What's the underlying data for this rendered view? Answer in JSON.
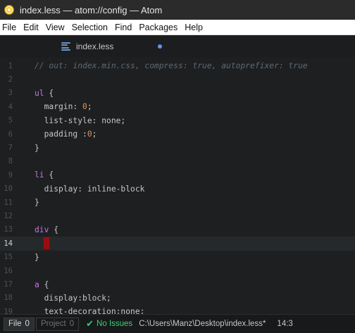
{
  "window": {
    "title": "index.less — atom://config — Atom"
  },
  "menu": [
    "File",
    "Edit",
    "View",
    "Selection",
    "Find",
    "Packages",
    "Help"
  ],
  "tab": {
    "label": "index.less",
    "modified": true
  },
  "editor": {
    "cursor_line": 14,
    "lines": [
      {
        "n": "1",
        "tokens": [
          {
            "t": "// out: index.min.css, compress: true, autoprefixer: true",
            "c": "comment"
          }
        ]
      },
      {
        "n": "2",
        "tokens": []
      },
      {
        "n": "3",
        "tokens": [
          {
            "t": "ul",
            "c": "sel"
          },
          {
            "t": " {",
            "c": "plain"
          }
        ]
      },
      {
        "n": "4",
        "tokens": [
          {
            "t": "  margin",
            "c": "prop"
          },
          {
            "t": ": ",
            "c": "plain"
          },
          {
            "t": "0",
            "c": "num"
          },
          {
            "t": ";",
            "c": "plain"
          }
        ]
      },
      {
        "n": "5",
        "tokens": [
          {
            "t": "  list-style",
            "c": "prop"
          },
          {
            "t": ": none;",
            "c": "plain"
          }
        ]
      },
      {
        "n": "6",
        "tokens": [
          {
            "t": "  padding",
            "c": "prop"
          },
          {
            "t": " :",
            "c": "plain"
          },
          {
            "t": "0",
            "c": "num"
          },
          {
            "t": ";",
            "c": "plain"
          }
        ]
      },
      {
        "n": "7",
        "tokens": [
          {
            "t": "}",
            "c": "plain"
          }
        ]
      },
      {
        "n": "8",
        "tokens": []
      },
      {
        "n": "9",
        "tokens": [
          {
            "t": "li",
            "c": "sel"
          },
          {
            "t": " {",
            "c": "plain"
          }
        ]
      },
      {
        "n": "10",
        "tokens": [
          {
            "t": "  display",
            "c": "prop"
          },
          {
            "t": ": inline-block",
            "c": "plain"
          }
        ]
      },
      {
        "n": "11",
        "tokens": [
          {
            "t": "}",
            "c": "plain"
          }
        ]
      },
      {
        "n": "12",
        "tokens": []
      },
      {
        "n": "13",
        "tokens": [
          {
            "t": "div",
            "c": "sel"
          },
          {
            "t": " {",
            "c": "plain"
          }
        ]
      },
      {
        "n": "14",
        "tokens": []
      },
      {
        "n": "15",
        "tokens": [
          {
            "t": "}",
            "c": "plain"
          }
        ]
      },
      {
        "n": "16",
        "tokens": []
      },
      {
        "n": "17",
        "tokens": [
          {
            "t": "a",
            "c": "sel"
          },
          {
            "t": " {",
            "c": "plain"
          }
        ]
      },
      {
        "n": "18",
        "tokens": [
          {
            "t": "  display",
            "c": "prop"
          },
          {
            "t": ":block;",
            "c": "plain"
          }
        ]
      },
      {
        "n": "19",
        "tokens": [
          {
            "t": "  text-decoration",
            "c": "prop"
          },
          {
            "t": ":none;",
            "c": "plain"
          }
        ]
      }
    ]
  },
  "status": {
    "file_tab": "File",
    "file_count": "0",
    "project_tab": "Project",
    "project_count": "0",
    "issues": "No Issues",
    "path": "C:\\Users\\Manz\\Desktop\\index.less*",
    "cursor_pos": "14:3"
  }
}
